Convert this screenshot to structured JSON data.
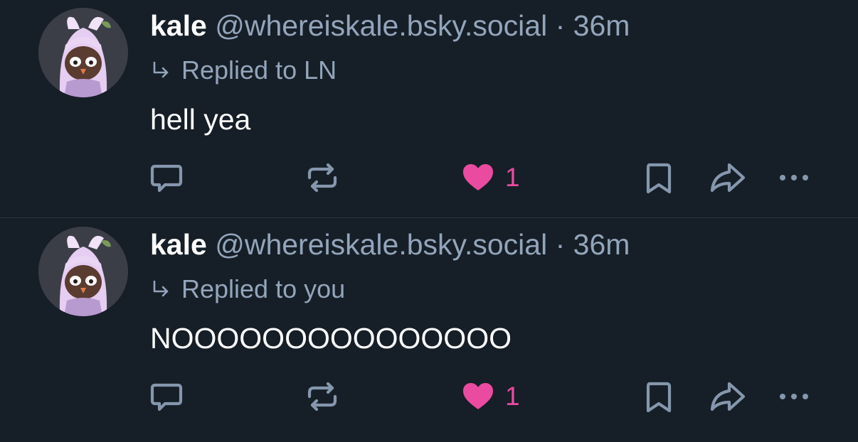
{
  "colors": {
    "background": "#161e27",
    "muted_text": "#93a5bb",
    "icon": "#8597ad",
    "like_pink": "#ea4ba0",
    "divider": "#2b3543"
  },
  "posts": [
    {
      "author": {
        "display_name": "kale",
        "handle": "@whereiskale.bsky.social"
      },
      "separator": "·",
      "time": "36m",
      "reply_to": "Replied to LN",
      "text": "hell yea",
      "actions": {
        "reply_icon": "comment-icon",
        "repost_icon": "repost-icon",
        "like_icon": "heart-icon",
        "like_count": "1",
        "liked": true,
        "bookmark_icon": "bookmark-icon",
        "share_icon": "share-icon",
        "more_icon": "ellipsis-icon"
      }
    },
    {
      "author": {
        "display_name": "kale",
        "handle": "@whereiskale.bsky.social"
      },
      "separator": "·",
      "time": "36m",
      "reply_to": "Replied to you",
      "text": "NOOOOOOOOOOOOOOO",
      "actions": {
        "reply_icon": "comment-icon",
        "repost_icon": "repost-icon",
        "like_icon": "heart-icon",
        "like_count": "1",
        "liked": true,
        "bookmark_icon": "bookmark-icon",
        "share_icon": "share-icon",
        "more_icon": "ellipsis-icon"
      }
    }
  ]
}
